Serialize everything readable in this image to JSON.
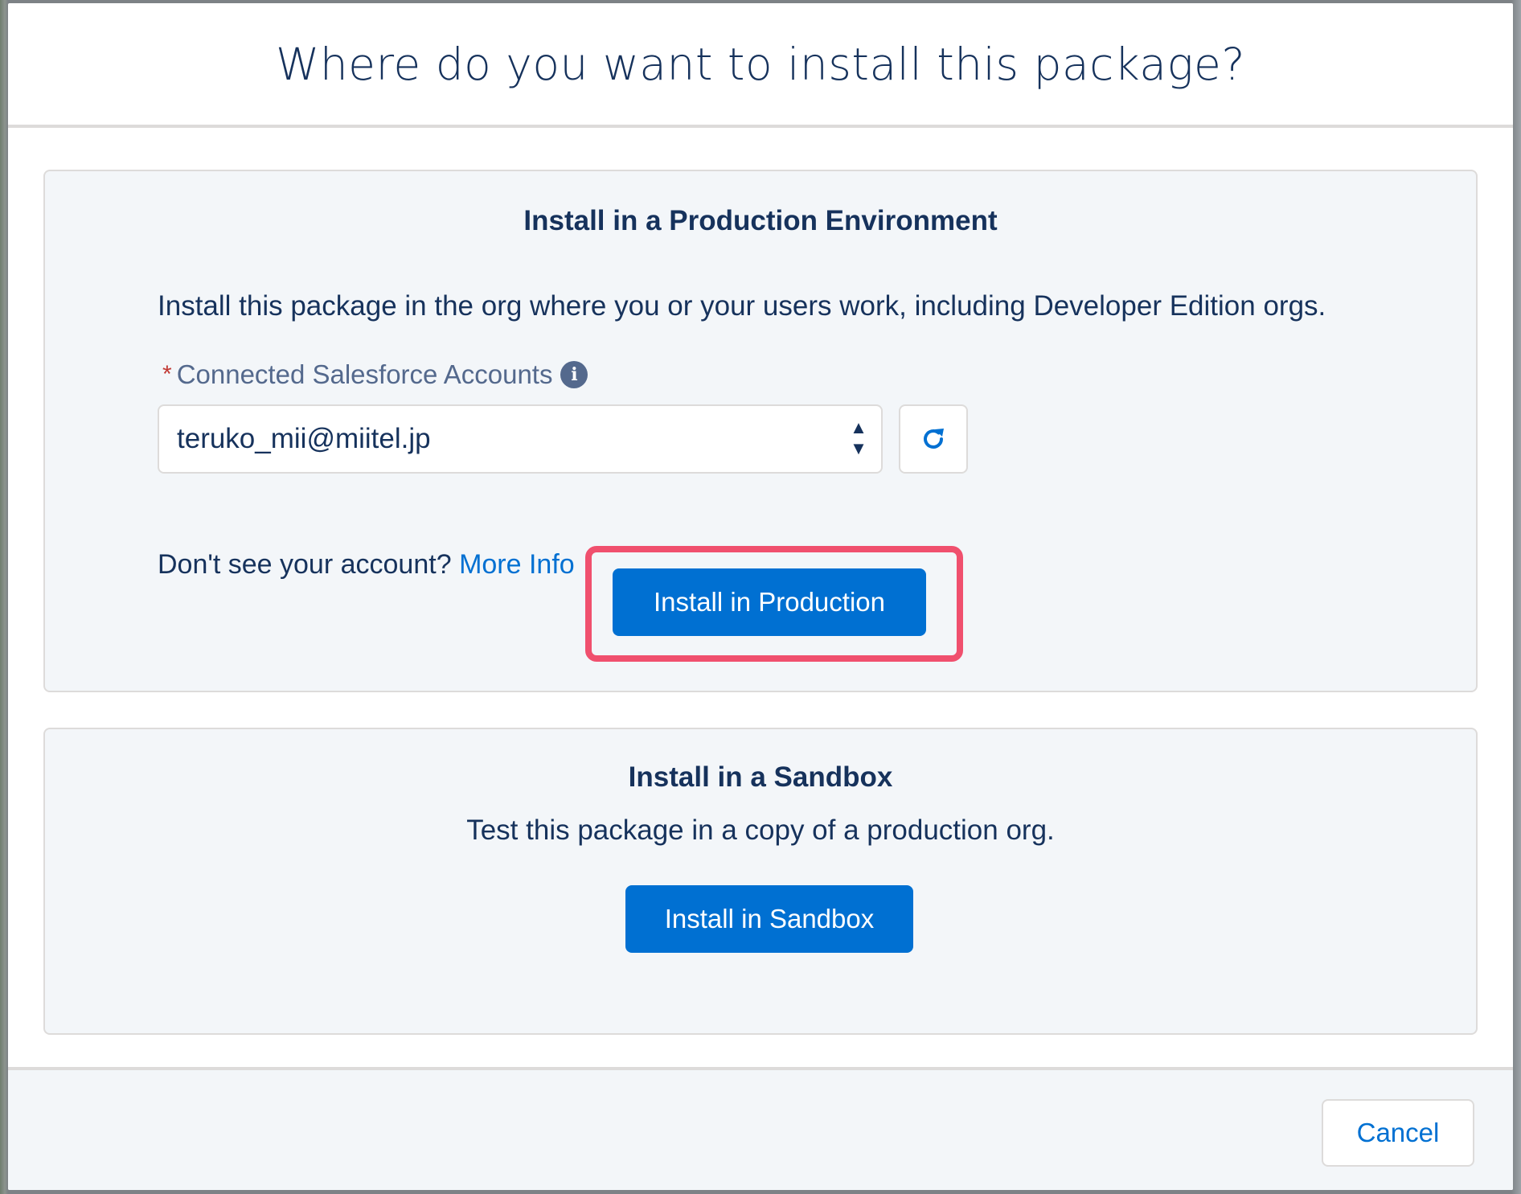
{
  "modal": {
    "title": "Where do you want to install this package?"
  },
  "production": {
    "title": "Install in a Production Environment",
    "description": "Install this package in the org where you or your users work, including Developer Edition orgs.",
    "field_required_marker": "*",
    "field_label": "Connected Salesforce Accounts",
    "info_icon": "info-icon",
    "selected_account": "teruko_mii@miitel.jp",
    "refresh_icon": "refresh-icon",
    "help_text": "Don't see your account?",
    "help_link": "More Info",
    "button_label": "Install in Production",
    "highlight_color": "#f0506e"
  },
  "sandbox": {
    "title": "Install in a Sandbox",
    "description": "Test this package in a copy of a production org.",
    "button_label": "Install in Sandbox"
  },
  "footer": {
    "cancel_label": "Cancel"
  },
  "colors": {
    "brand": "#0070d2",
    "text": "#16325c",
    "card_bg": "#f3f6f9",
    "required": "#c23934"
  }
}
